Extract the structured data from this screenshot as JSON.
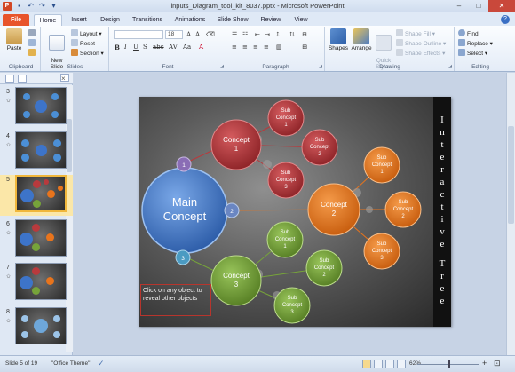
{
  "window": {
    "title": "inputs_Diagram_tool_kit_8037.pptx - Microsoft PowerPoint",
    "app_letter": "P",
    "minimize": "–",
    "maximize": "□",
    "close": "✕"
  },
  "tabs": [
    "File",
    "Home",
    "Insert",
    "Design",
    "Transitions",
    "Animations",
    "Slide Show",
    "Review",
    "View"
  ],
  "active_tab": "Home",
  "ribbon": {
    "clipboard": {
      "label": "Clipboard",
      "paste": "Paste"
    },
    "slides": {
      "label": "Slides",
      "new_slide": "New\nSlide",
      "layout": "Layout ▾",
      "reset": "Reset",
      "section": "Section ▾"
    },
    "font": {
      "label": "Font",
      "size": "18"
    },
    "paragraph": {
      "label": "Paragraph"
    },
    "drawing": {
      "label": "Drawing",
      "shapes": "Shapes",
      "arrange": "Arrange",
      "quick_styles": "Quick\nStyles",
      "shape_fill": "Shape Fill ▾",
      "shape_outline": "Shape Outline ▾",
      "shape_effects": "Shape Effects ▾"
    },
    "editing": {
      "label": "Editing",
      "find": "Find",
      "replace": "Replace ▾",
      "select": "Select ▾"
    }
  },
  "thumbnails": [
    {
      "num": "3",
      "selected": false
    },
    {
      "num": "4",
      "selected": false
    },
    {
      "num": "5",
      "selected": true
    },
    {
      "num": "6",
      "selected": false
    },
    {
      "num": "7",
      "selected": false
    },
    {
      "num": "8",
      "selected": false
    }
  ],
  "slide": {
    "side_text": "Interactive Tree",
    "main": "Main\nConcept",
    "concept1": "Concept\n1",
    "concept2": "Concept\n2",
    "concept3": "Concept\n3",
    "sub1_1": "Sub\nConcept\n1",
    "sub1_2": "Sub\nConcept\n2",
    "sub1_3": "Sub\nConcept\n3",
    "sub2_1": "Sub\nConcept\n1",
    "sub2_2": "Sub\nConcept\n2",
    "sub2_3": "Sub\nConcept\n3",
    "sub3_1": "Sub\nConcept\n1",
    "sub3_2": "Sub\nConcept\n2",
    "sub3_3": "Sub\nConcept\n3",
    "badge1": "1",
    "badge2": "2",
    "badge3": "3",
    "note": "Click on any object to reveal other objects",
    "colors": {
      "main": "#3d74c9",
      "red": "#b83a3d",
      "orange": "#e8741c",
      "green": "#76a33a",
      "purple": "#8a6db5",
      "teal": "#4b9bc2"
    }
  },
  "status": {
    "slide_info": "Slide 5 of 19",
    "theme": "\"Office Theme\"",
    "zoom": "62%"
  }
}
